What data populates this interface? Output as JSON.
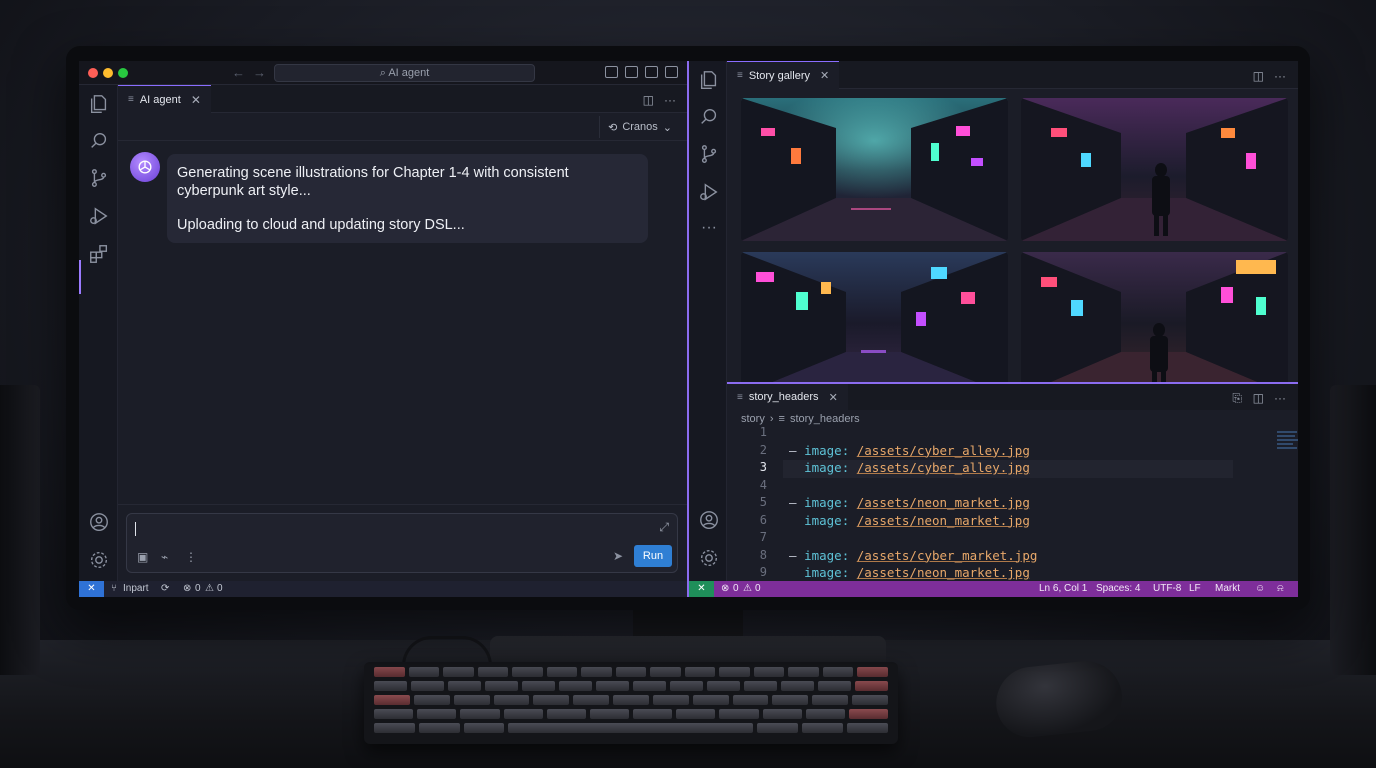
{
  "left_window": {
    "search_text": "AI agent",
    "tab_label": "AI agent",
    "model_selector": "Cranos",
    "message": {
      "line1": "Generating scene illustrations for Chapter 1-4 with consistent cyberpunk art style...",
      "line2": "Uploading to cloud and updating story DSL..."
    },
    "composer": {
      "input_value": "",
      "run_label": "Run"
    },
    "status": {
      "branch": "Inpart",
      "problems": "0",
      "warnings": "0"
    }
  },
  "right_window": {
    "gallery_tab": "Story gallery",
    "editor_tab": "story_headers",
    "breadcrumb": [
      "story",
      "story_headers"
    ],
    "code_lines": [
      {
        "n": "1",
        "dash": "",
        "key": "",
        "value": ""
      },
      {
        "n": "2",
        "dash": "– ",
        "key": "image:",
        "value": "/assets/cyber_alley.jpg"
      },
      {
        "n": "3",
        "dash": "  ",
        "key": "image:",
        "value": "/assets/cyber_alley.jpg"
      },
      {
        "n": "4",
        "dash": "",
        "key": "",
        "value": ""
      },
      {
        "n": "5",
        "dash": "– ",
        "key": "image:",
        "value": "/assets/neon_market.jpg"
      },
      {
        "n": "6",
        "dash": "  ",
        "key": "image:",
        "value": "/assets/neon_market.jpg"
      },
      {
        "n": "7",
        "dash": "",
        "key": "",
        "value": ""
      },
      {
        "n": "8",
        "dash": "– ",
        "key": "image:",
        "value": "/assets/cyber_market.jpg"
      },
      {
        "n": "9",
        "dash": "  ",
        "key": "image:",
        "value": "/assets/neon_market.jpg"
      }
    ],
    "current_line": "3",
    "status": {
      "problems": "0",
      "warnings": "0",
      "position": "Ln 6, Col 1",
      "spaces": "Spaces: 4",
      "encoding": "UTF-8",
      "eol": "LF",
      "language": "Markt"
    }
  },
  "colors": {
    "accent": "#8b6cf0",
    "run_button": "#2f7fd4",
    "status_left": "#1f2130",
    "status_right": "#7e2e9a"
  },
  "icons": [
    "explorer-icon",
    "search-icon",
    "source-control-icon",
    "run-debug-icon",
    "extensions-icon",
    "account-icon",
    "settings-icon"
  ]
}
